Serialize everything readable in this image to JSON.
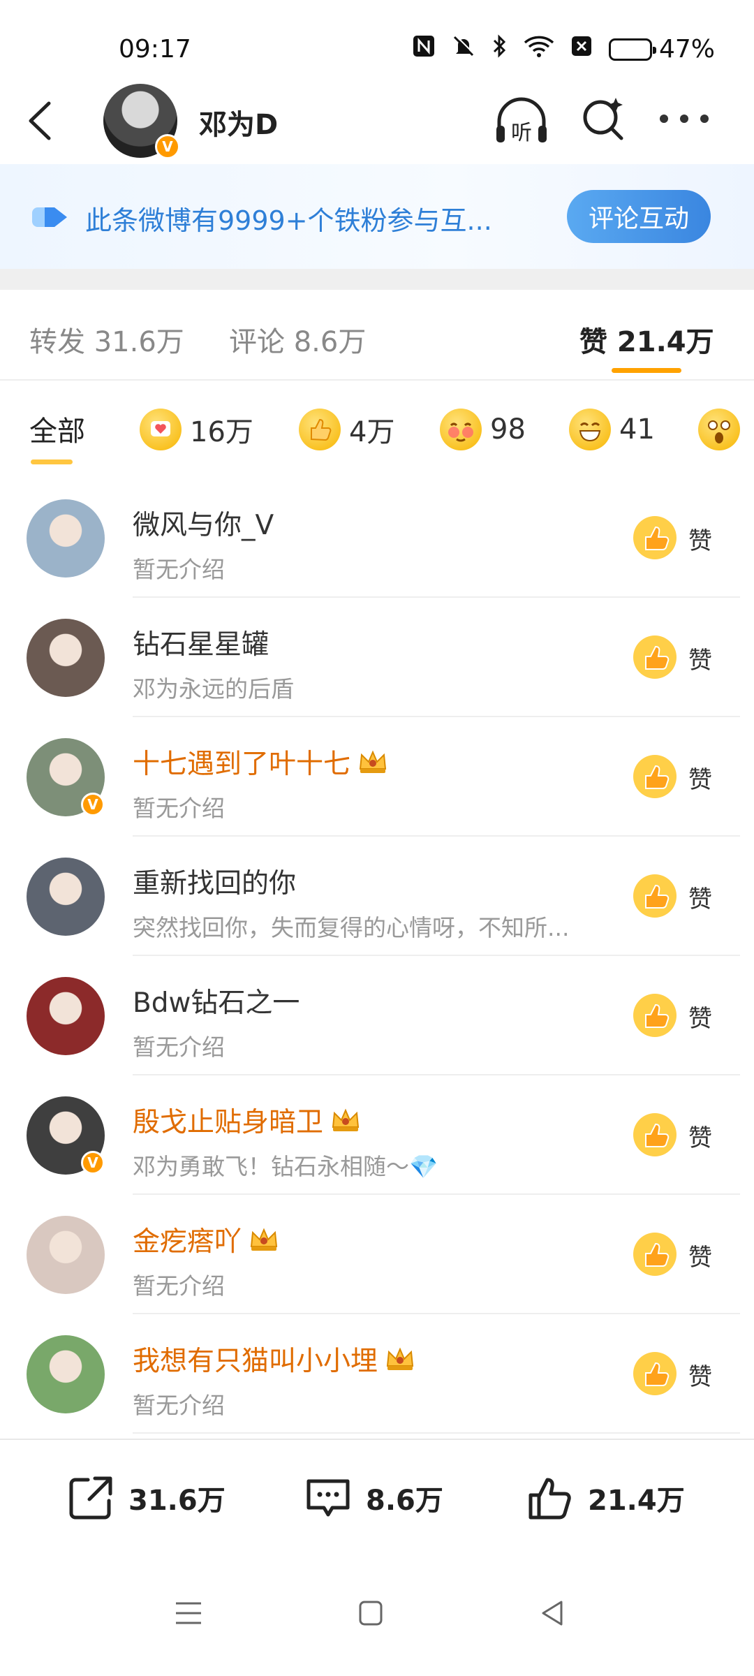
{
  "status_bar": {
    "time": "09:17",
    "battery_percent_text": "47%",
    "battery_level": 0.47
  },
  "header": {
    "account_name": "邓为D",
    "listen_label": "听"
  },
  "banner": {
    "text": "此条微博有9999+个铁粉参与互...",
    "button_label": "评论互动"
  },
  "tabs": [
    {
      "label": "转发 31.6万"
    },
    {
      "label": "评论 8.6万"
    },
    {
      "label": "赞 21.4万",
      "active": true
    }
  ],
  "reactions": [
    {
      "label": "全部",
      "active": true
    },
    {
      "icon": "heart-face-emoji",
      "count": "16万"
    },
    {
      "icon": "thumbs-up-emoji",
      "count": "4万"
    },
    {
      "icon": "shy-face-emoji",
      "count": "98"
    },
    {
      "icon": "grin-face-emoji",
      "count": "41"
    },
    {
      "icon": "surprised-face-emoji",
      "count": ""
    }
  ],
  "likers": [
    {
      "name": "微风与你_V",
      "bio": "暂无介绍",
      "vip": false,
      "verified": false,
      "like_label": "赞",
      "avatar_color": "#9bb3c9"
    },
    {
      "name": "钻石星星罐",
      "bio": "邓为永远的后盾",
      "vip": false,
      "verified": false,
      "like_label": "赞",
      "avatar_color": "#6b5a52"
    },
    {
      "name": "十七遇到了叶十七",
      "bio": "暂无介绍",
      "vip": true,
      "crown_level": "4",
      "verified": true,
      "like_label": "赞",
      "avatar_color": "#7d8f78"
    },
    {
      "name": "重新找回的你",
      "bio": "突然找回你，失而复得的心情呀，不知所...",
      "vip": false,
      "verified": false,
      "like_label": "赞",
      "avatar_color": "#5d6470"
    },
    {
      "name": "Bdw钻石之一",
      "bio": "暂无介绍",
      "vip": false,
      "verified": false,
      "like_label": "赞",
      "avatar_color": "#8c2a2a"
    },
    {
      "name": "殷戈止贴身暗卫",
      "bio": "邓为勇敢飞！钻石永相随～💎",
      "vip": true,
      "crown_level": "6",
      "verified": true,
      "like_label": "赞",
      "avatar_color": "#3f3f3f"
    },
    {
      "name": "金疙瘩吖",
      "bio": "暂无介绍",
      "vip": true,
      "crown_level": "",
      "verified": false,
      "like_label": "赞",
      "avatar_color": "#d9c8c0"
    },
    {
      "name": "我想有只猫叫小小埋",
      "bio": "暂无介绍",
      "vip": true,
      "crown_level": "",
      "verified": false,
      "like_label": "赞",
      "avatar_color": "#79a86a"
    }
  ],
  "action_bar": {
    "repost_count": "31.6万",
    "comment_count": "8.6万",
    "like_count": "21.4万"
  },
  "colors": {
    "accent_orange": "#ffa200",
    "link_blue": "#2e7fd7",
    "vip_name": "#e06c00"
  }
}
